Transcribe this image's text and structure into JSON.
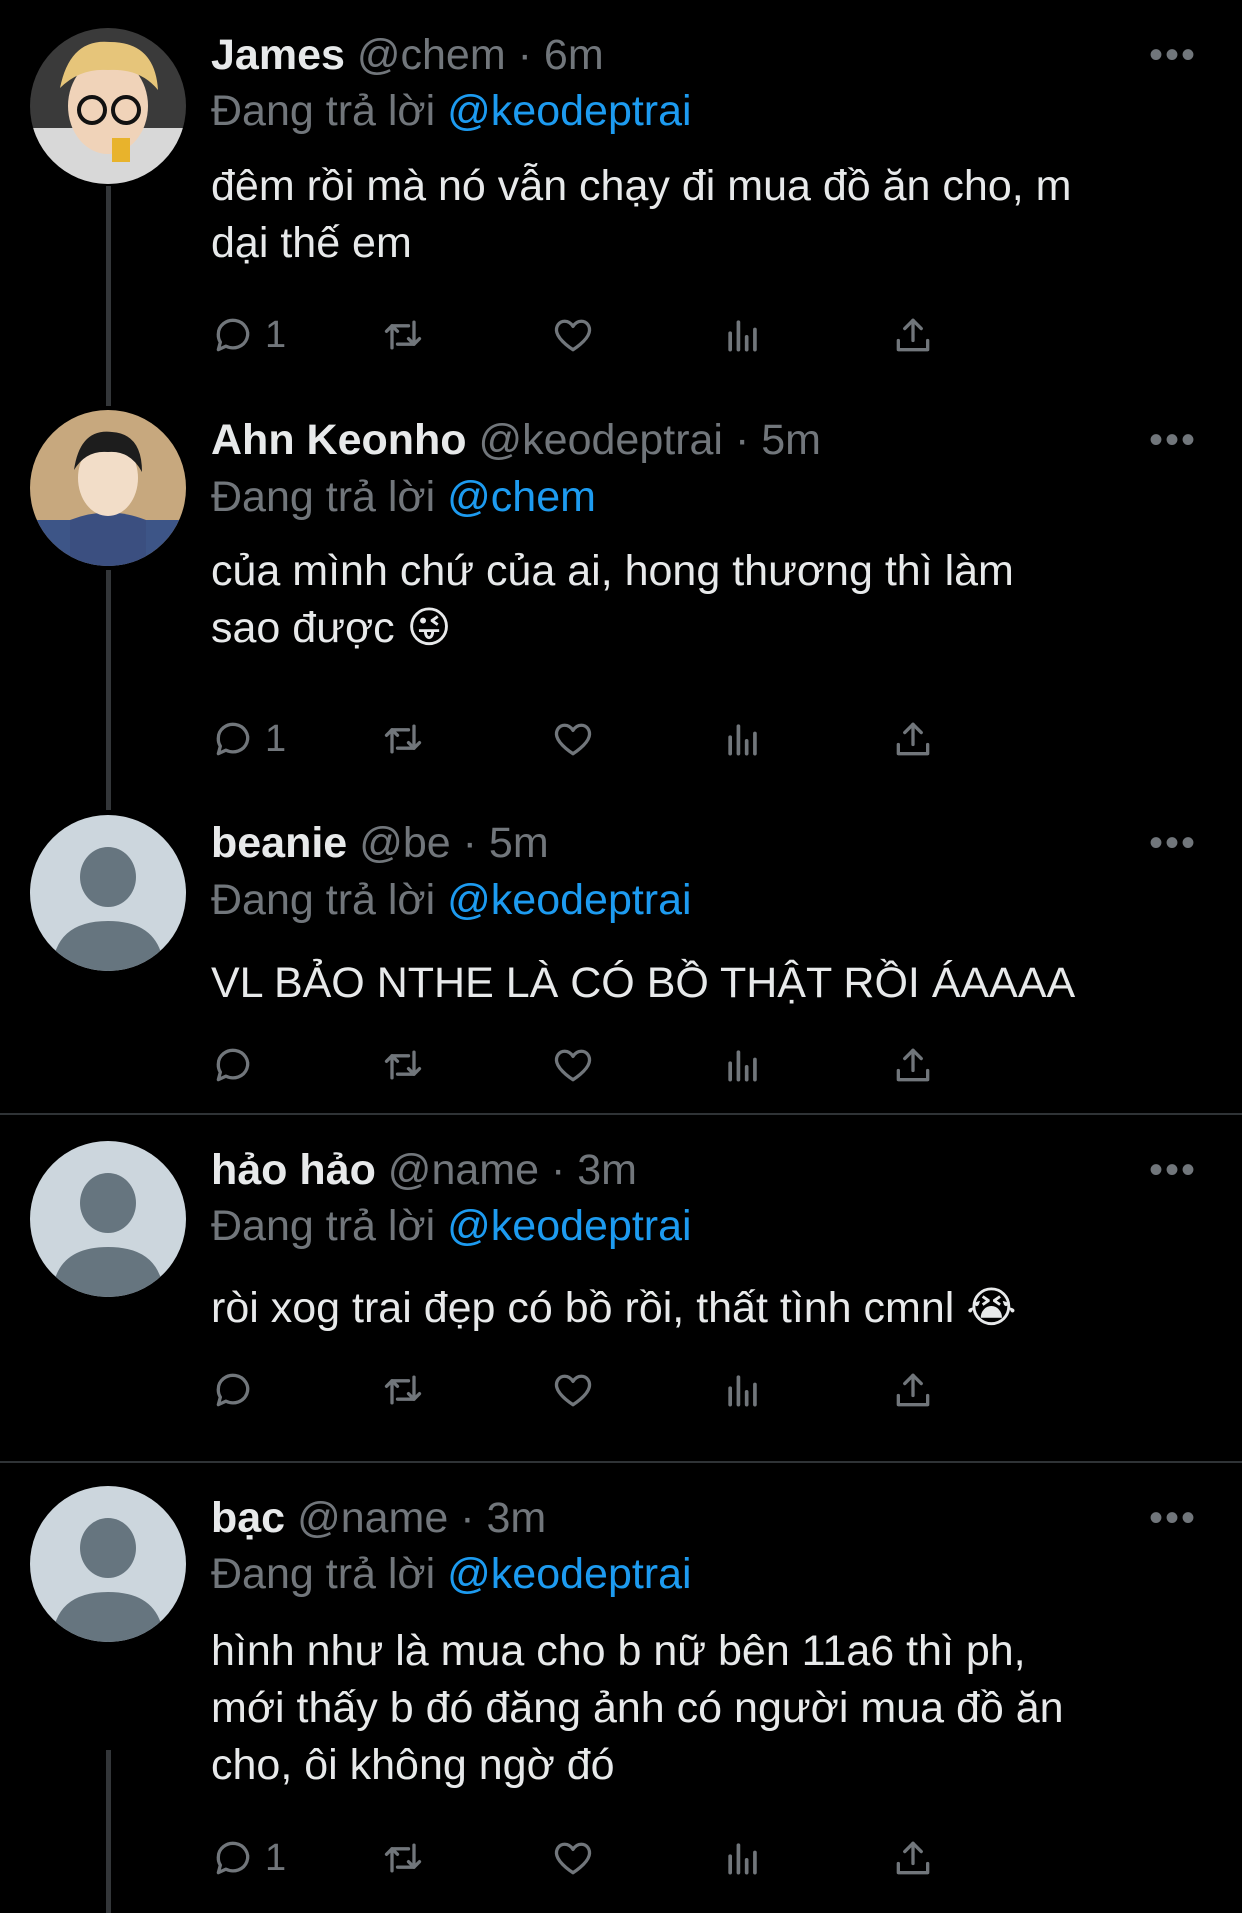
{
  "reply_prefix": "Đang trả lời",
  "more_glyph": "•••",
  "tweets": [
    {
      "name": "James",
      "handle": "@chem",
      "time": "6m",
      "reply_to": "@keodeptrai",
      "text": "đêm rồi mà nó vẫn chạy đi mua đồ ăn cho, m\ndại thế em",
      "reply_count": "1",
      "avatar": "photo"
    },
    {
      "name": "Ahn Keonho",
      "handle": "@keodeptrai",
      "time": "5m",
      "reply_to": "@chem",
      "text": "của mình chứ của ai, hong thương thì làm\nsao được 😜",
      "reply_count": "1",
      "avatar": "photo"
    },
    {
      "name": "beanie",
      "handle": "@be",
      "time": "5m",
      "reply_to": "@keodeptrai",
      "text": "VL BẢO NTHE LÀ CÓ BỒ THẬT RỒI ÁAAAA",
      "reply_count": "",
      "avatar": "default"
    },
    {
      "name": "hảo hảo",
      "handle": "@name",
      "time": "3m",
      "reply_to": "@keodeptrai",
      "text": "ròi xog trai đẹp có bồ rồi, thất tình cmnl 😭",
      "reply_count": "",
      "avatar": "default"
    },
    {
      "name": "bạc",
      "handle": "@name",
      "time": "3m",
      "reply_to": "@keodeptrai",
      "text": "hình như là mua cho b nữ bên 11a6 thì ph,\nmới thấy b đó đăng ảnh có người mua đồ ăn\ncho, ôi không ngờ đó",
      "reply_count": "1",
      "avatar": "default"
    }
  ],
  "colors": {
    "background": "#000000",
    "text": "#e7e9ea",
    "muted": "#71767b",
    "link": "#1d9bf0",
    "divider": "#2f3336"
  }
}
